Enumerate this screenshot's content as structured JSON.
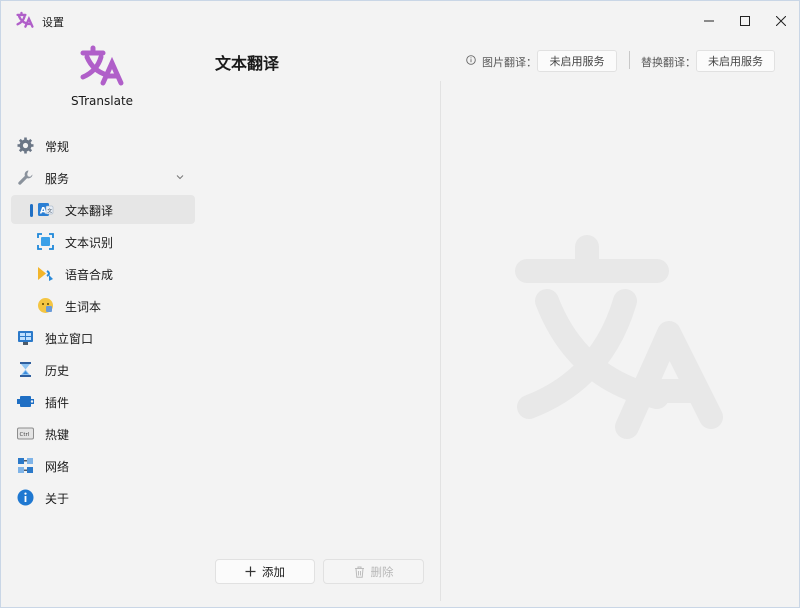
{
  "window": {
    "title": "设置",
    "minimize_icon": "minimize-icon",
    "maximize_icon": "maximize-icon",
    "close_icon": "close-icon"
  },
  "sidebar": {
    "app_name": "STranslate",
    "items": [
      {
        "label": "常规",
        "icon": "gear-icon"
      },
      {
        "label": "服务",
        "icon": "wrench-icon",
        "expanded": true
      },
      {
        "label": "文本翻译",
        "icon": "text-translate-icon",
        "active": true
      },
      {
        "label": "文本识别",
        "icon": "ocr-scan-icon"
      },
      {
        "label": "语音合成",
        "icon": "speech-icon"
      },
      {
        "label": "生词本",
        "icon": "vocabulary-icon"
      },
      {
        "label": "独立窗口",
        "icon": "window-icon"
      },
      {
        "label": "历史",
        "icon": "hourglass-icon"
      },
      {
        "label": "插件",
        "icon": "plugin-icon"
      },
      {
        "label": "热键",
        "icon": "keyboard-icon"
      },
      {
        "label": "网络",
        "icon": "network-icon"
      },
      {
        "label": "关于",
        "icon": "info-icon"
      }
    ]
  },
  "main": {
    "title": "文本翻译",
    "image_translate_label": "图片翻译：",
    "image_translate_value": "未启用服务",
    "replace_translate_label": "替换翻译：",
    "replace_translate_value": "未启用服务",
    "add_label": "添加",
    "delete_label": "删除"
  },
  "colors": {
    "accent": "#1f6fc4",
    "logo_purple": "#b05fc9",
    "watermark": "#e9e9e9"
  }
}
